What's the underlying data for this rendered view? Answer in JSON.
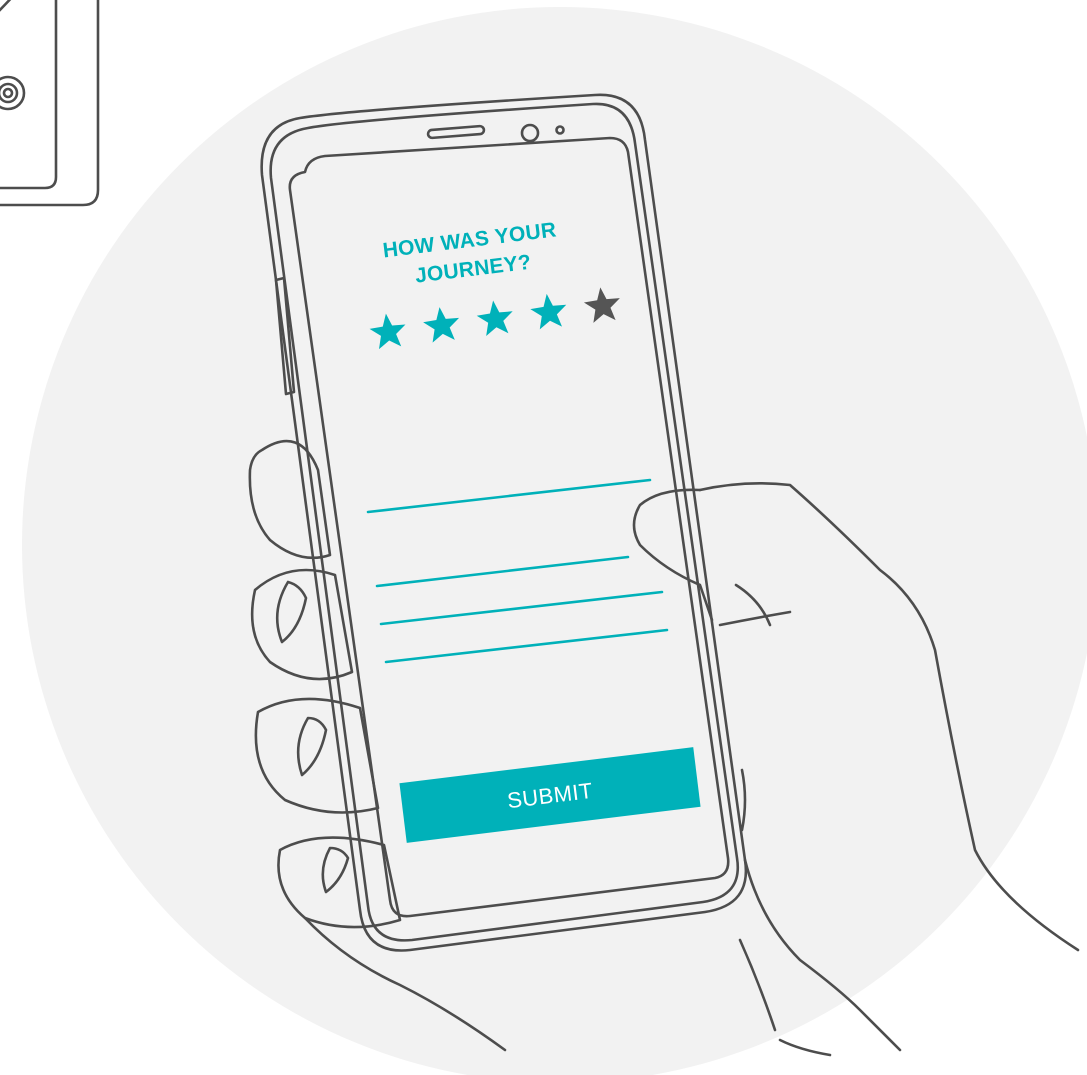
{
  "survey": {
    "question_line1": "HOW WAS YOUR",
    "question_line2": "JOURNEY?",
    "submit_label": "SUBMIT"
  },
  "rating": {
    "value": 4,
    "max": 5,
    "icon": "star-icon"
  },
  "feedback": {
    "line_count": 4
  },
  "colors": {
    "accent": "#00b1b9",
    "star_empty": "#555555",
    "outline": "#4d4d4d",
    "background_circle": "#f2f2f2",
    "screen": "#ffffff",
    "button_text": "#ffffff"
  }
}
